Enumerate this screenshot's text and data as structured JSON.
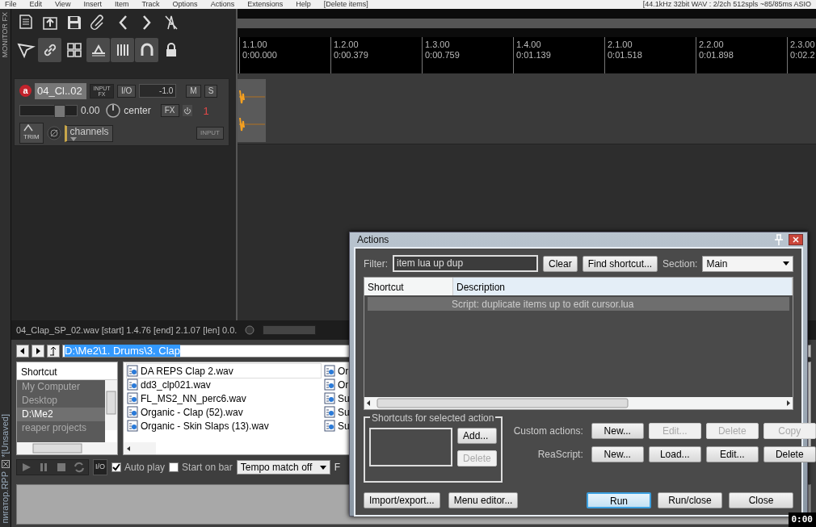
{
  "menu_bar": {
    "items": [
      "File",
      "Edit",
      "View",
      "Insert",
      "Item",
      "Track",
      "Options",
      "Actions",
      "Extensions",
      "Help"
    ],
    "undo_hint": "[Delete items]",
    "format_info": "[44.1kHz 32bit WAV : 2/2ch 512spls ~85/85ms ASIO"
  },
  "side_tabs": {
    "monitor": "MONITOR FX",
    "project": "*[Unsaved]",
    "file": "пигатор.RPP"
  },
  "toolbar": {
    "row_1": [
      {
        "on": false
      },
      {
        "on": false
      },
      {
        "on": false
      },
      {
        "on": false
      },
      {
        "on": false
      },
      {
        "on": false
      },
      {
        "on": false
      }
    ],
    "row_2": [
      {
        "on": false
      },
      {
        "on": true
      },
      {
        "on": false
      },
      {
        "on": true
      },
      {
        "on": true
      },
      {
        "on": true
      },
      {
        "on": false
      }
    ]
  },
  "ruler": [
    {
      "bar": "1.1.00",
      "time": "0:00.000"
    },
    {
      "bar": "1.2.00",
      "time": "0:00.379"
    },
    {
      "bar": "1.3.00",
      "time": "0:00.759"
    },
    {
      "bar": "1.4.00",
      "time": "0:01.139"
    },
    {
      "bar": "2.1.00",
      "time": "0:01.518"
    },
    {
      "bar": "2.2.00",
      "time": "0:01.898"
    },
    {
      "bar": "2.3.00",
      "time": "0:02.2"
    }
  ],
  "track": {
    "record_armed": true,
    "arm_label": "a",
    "name": "04_Cl..02",
    "input_fx": "INPUT FX",
    "io": "I/O",
    "volume_readout": "-1.0",
    "mute": "M",
    "solo": "S",
    "volume": "0.00",
    "volume_slider": {
      "level": 0.72
    },
    "pan": "center",
    "fx": "FX",
    "number": "1",
    "trim": "TRIM",
    "channels": "channels",
    "input": "INPUT"
  },
  "item_info": "04_Clap_SP_02.wav [start] 1.4.76 [end] 2.1.07 [len] 0.0.",
  "media_explorer": {
    "path": "D:\\Me2\\1. Drums\\3. Clap",
    "shortcut_header": "Shortcut",
    "shortcuts": [
      {
        "label": "My Computer",
        "selected": false
      },
      {
        "label": "Desktop",
        "selected": false
      },
      {
        "label": "D:\\Me2",
        "selected": true
      },
      {
        "label": "reaper projects",
        "selected": false
      }
    ],
    "files": [
      {
        "name": "DA REPS Clap 2.wav",
        "selected": true
      },
      {
        "name": "dd3_clp021.wav",
        "selected": false
      },
      {
        "name": "FL_MS2_NN_perc6.wav",
        "selected": false
      },
      {
        "name": "Organic - Clap (52).wav",
        "selected": false
      },
      {
        "name": "Organic - Skin Slaps (13).wav",
        "selected": false
      }
    ],
    "files_column_2": [
      "Or",
      "Or",
      "Su",
      "Su",
      "Su"
    ],
    "io": "I/O",
    "auto_play": {
      "label": "Auto play",
      "checked": true
    },
    "start_on_bar": {
      "label": "Start on bar",
      "checked": false
    },
    "tempo": "Tempo match off",
    "cut_label": "F"
  },
  "actions": {
    "title": "Actions",
    "filter_label": "Filter:",
    "filter": "item lua up dup",
    "clear": "Clear",
    "find_shortcut": "Find shortcut...",
    "section_label": "Section:",
    "section": "Main",
    "columns": [
      "Shortcut",
      "Description"
    ],
    "rows": [
      {
        "description": "Script: duplicate items up to edit cursor.lua",
        "selected": true
      }
    ],
    "shortcuts_group": "Shortcuts for selected action",
    "add": {
      "label": "Add...",
      "disabled": false
    },
    "delete": {
      "label": "Delete",
      "disabled": true
    },
    "button_rows": [
      {
        "label": "Custom actions:",
        "buttons": [
          {
            "label": "New...",
            "disabled": false
          },
          {
            "label": "Edit...",
            "disabled": true
          },
          {
            "label": "Delete",
            "disabled": true
          },
          {
            "label": "Copy",
            "disabled": true
          }
        ]
      },
      {
        "label": "ReaScript:",
        "buttons": [
          {
            "label": "New...",
            "disabled": false
          },
          {
            "label": "Load...",
            "disabled": false
          },
          {
            "label": "Edit...",
            "disabled": false
          },
          {
            "label": "Delete",
            "disabled": false
          }
        ]
      }
    ],
    "bottom_left": [
      "Import/export...",
      "Menu editor..."
    ],
    "bottom_right": [
      {
        "label": "Run",
        "default": true
      },
      {
        "label": "Run/close",
        "default": false
      },
      {
        "label": "Close",
        "default": false
      }
    ]
  },
  "recorder_time": "0:00"
}
